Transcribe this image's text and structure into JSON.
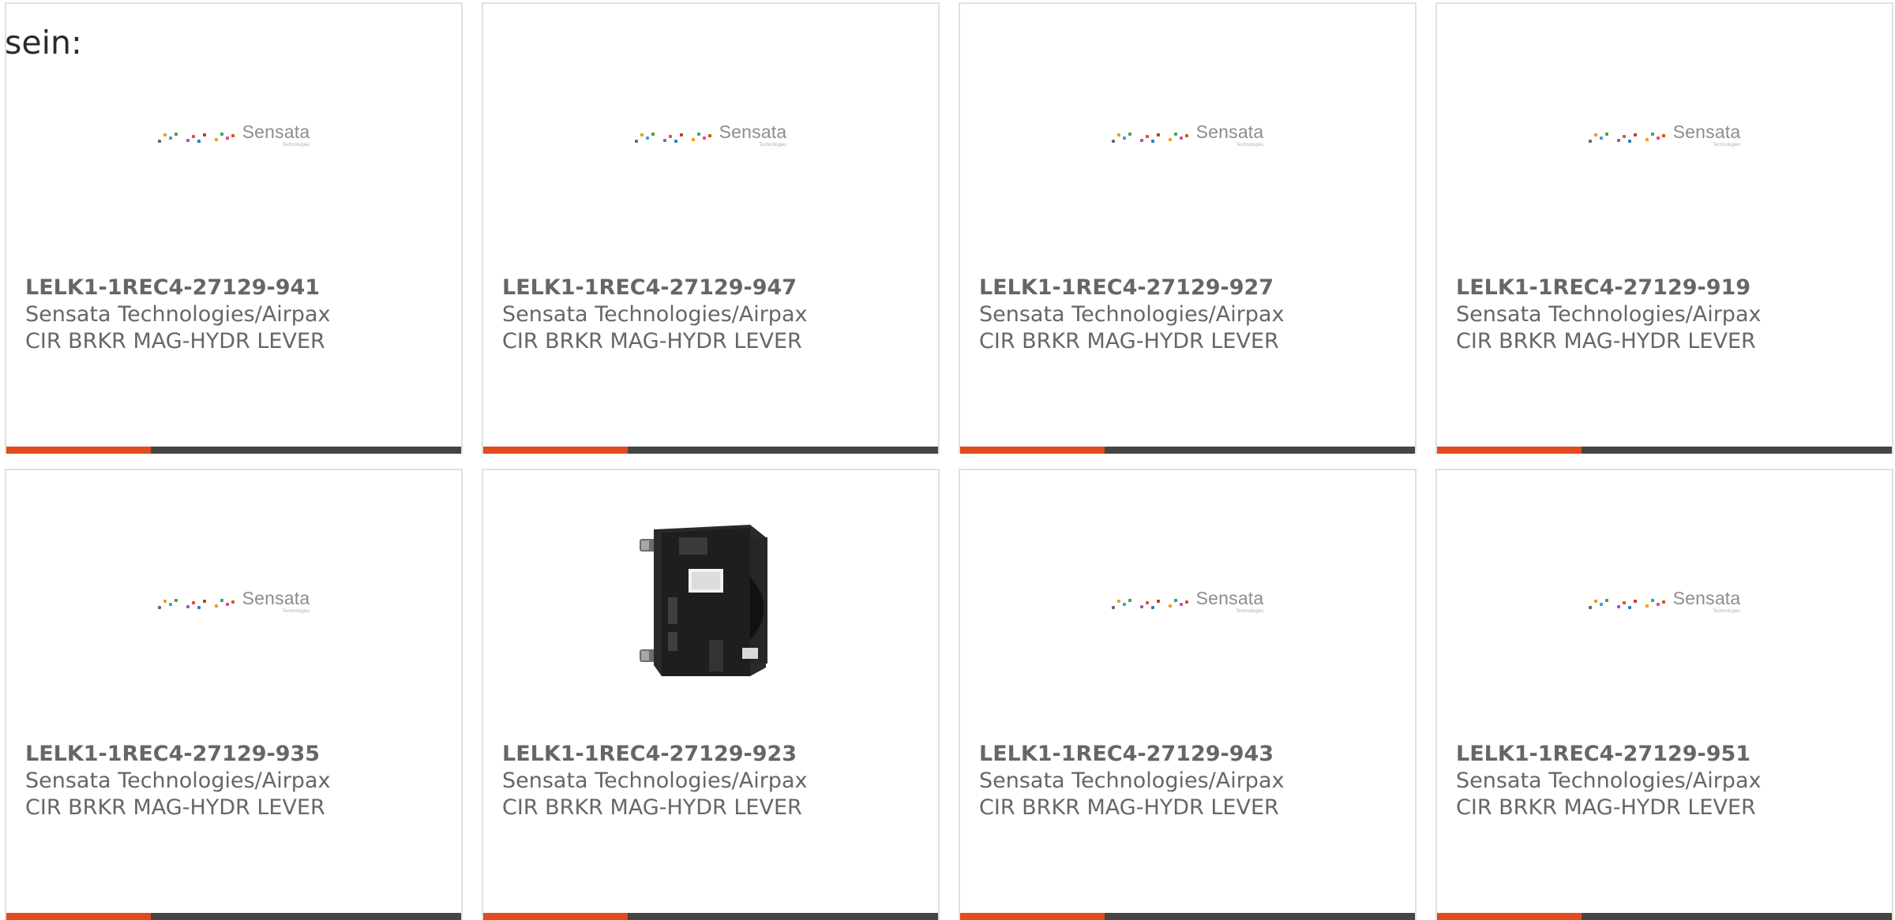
{
  "intro": {
    "text": "sein:"
  },
  "colors": {
    "accent": "#e14b1d",
    "bar": "#454545",
    "border": "#e0e0e0",
    "text": "#666666"
  },
  "logo": {
    "word": "Sensata",
    "tagline": "Technologies",
    "dot_colors": [
      "#6a6a6a",
      "#e0a020",
      "#39a0d8",
      "#4a9e44",
      "#9b59b6",
      "#e74c3c",
      "#2c7fb8",
      "#c0392b",
      "#f39c12",
      "#27ae60",
      "#e84393",
      "#d35400"
    ]
  },
  "cards": [
    {
      "part_number": "LELK1-1REC4-27129-941",
      "manufacturer": "Sensata Technologies/Airpax",
      "description": "CIR BRKR MAG-HYDR LEVER",
      "image": "sensata-logo"
    },
    {
      "part_number": "LELK1-1REC4-27129-947",
      "manufacturer": "Sensata Technologies/Airpax",
      "description": "CIR BRKR MAG-HYDR LEVER",
      "image": "sensata-logo"
    },
    {
      "part_number": "LELK1-1REC4-27129-927",
      "manufacturer": "Sensata Technologies/Airpax",
      "description": "CIR BRKR MAG-HYDR LEVER",
      "image": "sensata-logo"
    },
    {
      "part_number": "LELK1-1REC4-27129-919",
      "manufacturer": "Sensata Technologies/Airpax",
      "description": "CIR BRKR MAG-HYDR LEVER",
      "image": "sensata-logo"
    },
    {
      "part_number": "LELK1-1REC4-27129-935",
      "manufacturer": "Sensata Technologies/Airpax",
      "description": "CIR BRKR MAG-HYDR LEVER",
      "image": "sensata-logo"
    },
    {
      "part_number": "LELK1-1REC4-27129-923",
      "manufacturer": "Sensata Technologies/Airpax",
      "description": "CIR BRKR MAG-HYDR LEVER",
      "image": "circuit-breaker-photo"
    },
    {
      "part_number": "LELK1-1REC4-27129-943",
      "manufacturer": "Sensata Technologies/Airpax",
      "description": "CIR BRKR MAG-HYDR LEVER",
      "image": "sensata-logo"
    },
    {
      "part_number": "LELK1-1REC4-27129-951",
      "manufacturer": "Sensata Technologies/Airpax",
      "description": "CIR BRKR MAG-HYDR LEVER",
      "image": "sensata-logo"
    }
  ]
}
